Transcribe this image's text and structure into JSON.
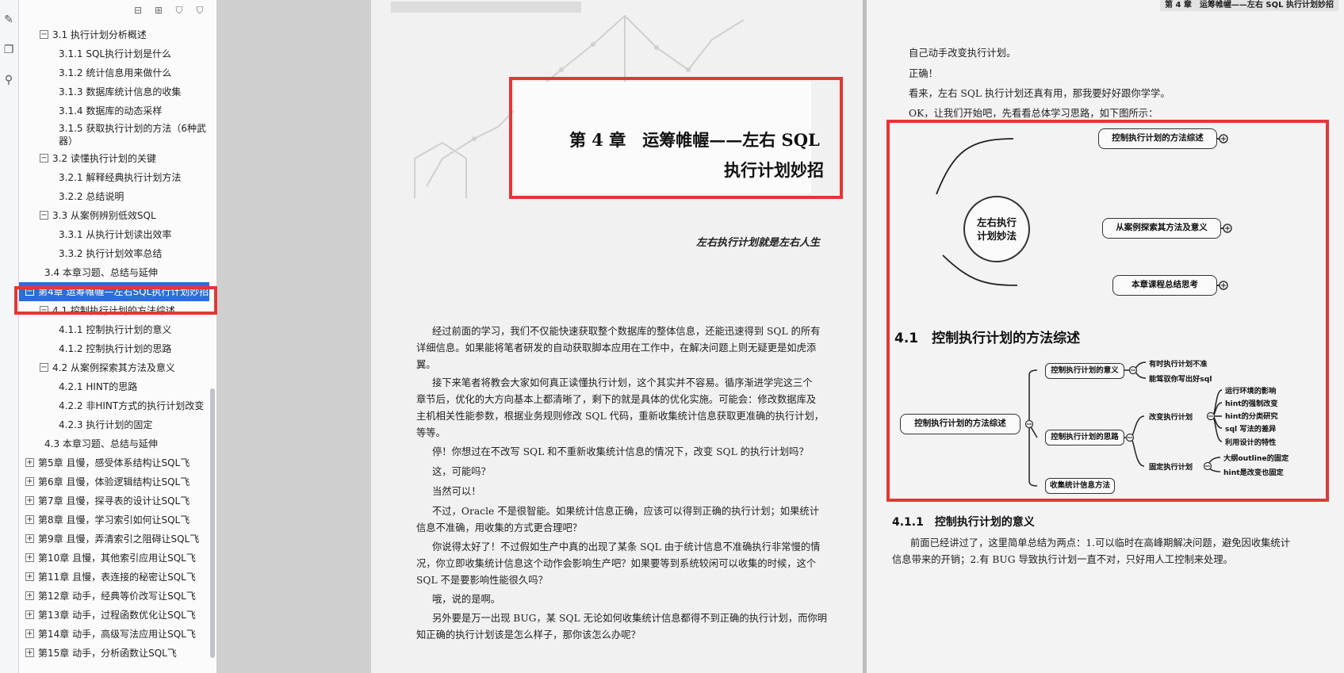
{
  "accent": "#e53636",
  "selection_color": "#2b6fd6",
  "rail": {
    "icons": [
      "edit-icon",
      "pages-icon",
      "search-icon"
    ]
  },
  "panel": {
    "tools": [
      "collapse-all-icon",
      "expand-all-icon",
      "bookmark-add-icon",
      "bookmark-icon"
    ],
    "items": [
      {
        "level": 1,
        "toggle": "−",
        "label": "3.1 执行计划分析概述"
      },
      {
        "level": 2,
        "toggle": "",
        "label": "3.1.1 SQL执行计划是什么"
      },
      {
        "level": 2,
        "toggle": "",
        "label": "3.1.2 统计信息用来做什么"
      },
      {
        "level": 2,
        "toggle": "",
        "label": "3.1.3 数据库统计信息的收集"
      },
      {
        "level": 2,
        "toggle": "",
        "label": "3.1.4 数据库的动态采样"
      },
      {
        "level": 2,
        "toggle": "",
        "label": "3.1.5 获取执行计划的方法（6种武器）"
      },
      {
        "level": 1,
        "toggle": "−",
        "label": "3.2 读懂执行计划的关键"
      },
      {
        "level": 2,
        "toggle": "",
        "label": "3.2.1 解释经典执行计划方法"
      },
      {
        "level": 2,
        "toggle": "",
        "label": "3.2.2 总结说明"
      },
      {
        "level": 1,
        "toggle": "−",
        "label": "3.3 从案例辨别低效SQL"
      },
      {
        "level": 2,
        "toggle": "",
        "label": "3.3.1 从执行计划读出效率"
      },
      {
        "level": 2,
        "toggle": "",
        "label": "3.3.2 执行计划效率总结"
      },
      {
        "level": 1,
        "toggle": "",
        "label": "3.4 本章习题、总结与延伸"
      },
      {
        "level": 0,
        "toggle": "−",
        "label": "第4章 运筹帷幄—左右SQL执行计划妙招",
        "selected": true
      },
      {
        "level": 1,
        "toggle": "−",
        "label": "4.1 控制执行计划的方法综述"
      },
      {
        "level": 2,
        "toggle": "",
        "label": "4.1.1 控制执行计划的意义"
      },
      {
        "level": 2,
        "toggle": "",
        "label": "4.1.2 控制执行计划的思路"
      },
      {
        "level": 1,
        "toggle": "−",
        "label": "4.2 从案例探索其方法及意义"
      },
      {
        "level": 2,
        "toggle": "",
        "label": "4.2.1 HINT的思路"
      },
      {
        "level": 2,
        "toggle": "",
        "label": "4.2.2 非HINT方式的执行计划改变"
      },
      {
        "level": 2,
        "toggle": "",
        "label": "4.2.3 执行计划的固定"
      },
      {
        "level": 1,
        "toggle": "",
        "label": "4.3 本章习题、总结与延伸"
      },
      {
        "level": 0,
        "toggle": "+",
        "label": "第5章 且慢，感受体系结构让SQL飞"
      },
      {
        "level": 0,
        "toggle": "+",
        "label": "第6章 且慢，体验逻辑结构让SQL飞"
      },
      {
        "level": 0,
        "toggle": "+",
        "label": "第7章 且慢，探寻表的设计让SQL飞"
      },
      {
        "level": 0,
        "toggle": "+",
        "label": "第8章 且慢，学习索引如何让SQL飞"
      },
      {
        "level": 0,
        "toggle": "+",
        "label": "第9章 且慢，弄清索引之阻碍让SQL飞"
      },
      {
        "level": 0,
        "toggle": "+",
        "label": "第10章 且慢，其他索引应用让SQL飞"
      },
      {
        "level": 0,
        "toggle": "+",
        "label": "第11章 且慢，表连接的秘密让SQL飞"
      },
      {
        "level": 0,
        "toggle": "+",
        "label": "第12章 动手，经典等价改写让SQL飞"
      },
      {
        "level": 0,
        "toggle": "+",
        "label": "第13章 动手，过程函数优化让SQL飞"
      },
      {
        "level": 0,
        "toggle": "+",
        "label": "第14章 动手，高级写法应用让SQL飞"
      },
      {
        "level": 0,
        "toggle": "+",
        "label": "第15章 动手，分析函数让SQL飞"
      }
    ]
  },
  "left_page": {
    "chapter_title_line1": "第 4 章　运筹帷幄——左右 SQL",
    "chapter_title_line2": "执行计划妙招",
    "epigraph": "左右执行计划就是左右人生",
    "paragraphs": [
      "经过前面的学习，我们不仅能快速获取整个数据库的整体信息，还能迅速得到 SQL 的所有",
      "详细信息。如果能将笔者研发的自动获取脚本应用在工作中，在解决问题上则无疑更是如虎添",
      "翼。",
      "接下来笔者将教会大家如何真正读懂执行计划，这个其实并不容易。循序渐进学完这三个",
      "章节后，优化的大方向基本上都清晰了，剩下的就是具体的优化实施。可能会：修改数据库及",
      "主机相关性能参数，根据业务规则修改 SQL 代码，重新收集统计信息获取更准确的执行计划，",
      "等等。",
      "停！你想过在不改写 SQL 和不重新收集统计信息的情况下，改变 SQL 的执行计划吗？",
      "这，可能吗？",
      "当然可以！",
      "不过，Oracle 不是很智能。如果统计信息正确，应该可以得到正确的执行计划；如果统计",
      "信息不准确，用收集的方式更合理吧？",
      "你说得太好了！不过假如生产中真的出现了某条 SQL 由于统计信息不准确执行非常慢的情",
      "况，你立即收集统计信息这个动作会影响生产吧？如果要等到系统较闲可以收集的时候，这个",
      "SQL 不是要影响性能很久吗？",
      "哦，说的是啊。",
      "另外要是万一出现 BUG，某 SQL 无论如何收集统计信息都得不到正确的执行计划，而你明",
      "知正确的执行计划该是怎么样子，那你该怎么办呢？"
    ]
  },
  "right_page": {
    "header": "第 4 章　运筹帷幄——左右 SQL 执行计划妙招",
    "lines": [
      "自己动手改变执行计划。",
      "正确！",
      "看来，左右 SQL 执行计划还真有用，那我要好好跟你学学。",
      "OK，让我们开始吧，先看看总体学习思路，如下图所示："
    ],
    "map1": {
      "center": "左右执行\n计划妙法",
      "branches": [
        "控制执行计划的方法综述",
        "从案例探索其方法及意义",
        "本章课程总结思考"
      ]
    },
    "section_title": "4.1　控制执行计划的方法综述",
    "map2": {
      "root": "控制执行计划的方法综述",
      "level1": [
        "控制执行计划的意义",
        "控制执行计划的思路",
        "收集统计信息方法"
      ],
      "meaning_leaves": [
        "有时执行计划不准",
        "能驾驭你写出好sql"
      ],
      "level2": [
        "改变执行计划",
        "固定执行计划"
      ],
      "change_leaves": [
        "运行环境的影响",
        "hint的强制改变",
        "hint的分类研究",
        "sql 写法的差异",
        "利用设计的特性"
      ],
      "fix_leaves": [
        "大纲outline的固定",
        "hint是改变也固定"
      ]
    },
    "subsection_title": "4.1.1　控制执行计划的意义",
    "body": [
      "前面已经讲过了，这里简单总结为两点：1.可以临时在高峰期解决问题，避免因收集统计",
      "信息带来的开销；2.有 BUG 导致执行计划一直不对，只好用人工控制来处理。"
    ]
  }
}
